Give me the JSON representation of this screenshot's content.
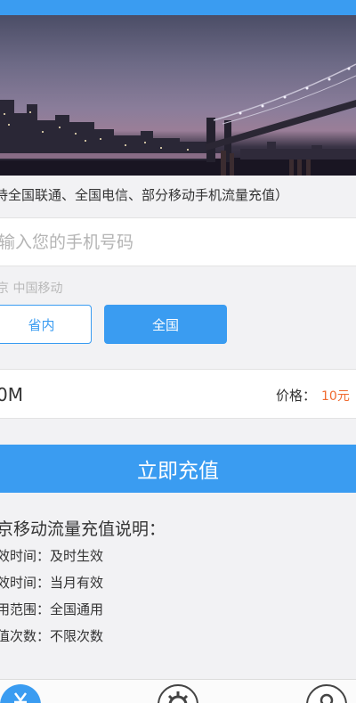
{
  "banner": {
    "alt": "city night bridge"
  },
  "notice": "持全国联通、全国电信、部分移动手机流量充值）",
  "phone": {
    "placeholder": "输入您的手机号码",
    "value": ""
  },
  "carrier": "京  中国移动",
  "scope": {
    "province_label": "省内",
    "national_label": "全国",
    "selected": "全国"
  },
  "plan": {
    "size": "0M",
    "price_label": "价格：",
    "price": "10元"
  },
  "recharge_label": "立即充值",
  "description": {
    "title": "京移动流量充值说明：",
    "lines": [
      "效时间：及时生效",
      "效时间：当月有效",
      "用范围：全国通用",
      "值次数：不限次数"
    ]
  },
  "colors": {
    "accent": "#3a9cf1",
    "price": "#f06a30"
  },
  "nav_icons": [
    "home-icon",
    "gear-icon",
    "user-icon"
  ]
}
